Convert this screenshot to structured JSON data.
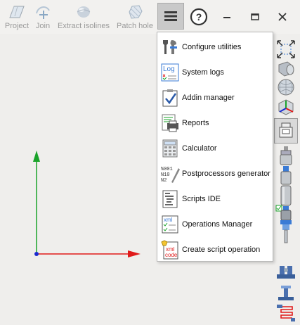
{
  "toolbar": {
    "items": [
      {
        "label": "Project",
        "icon": "project-icon"
      },
      {
        "label": "Join",
        "icon": "join-icon"
      },
      {
        "label": "Extract isolines",
        "icon": "extract-isolines-icon"
      },
      {
        "label": "Patch hole",
        "icon": "patch-hole-icon"
      }
    ],
    "menu_icon": "hamburger-menu-icon",
    "help_glyph": "?",
    "minimize_icon": "minimize-icon",
    "restore_icon": "restore-icon",
    "close_icon": "close-icon"
  },
  "menu": {
    "items": [
      {
        "label": "Configure utilities",
        "icon": "configure-utilities-icon"
      },
      {
        "label": "System logs",
        "icon": "system-logs-icon",
        "icon_text": "Log"
      },
      {
        "label": "Addin manager",
        "icon": "addin-manager-icon"
      },
      {
        "label": "Reports",
        "icon": "reports-icon"
      },
      {
        "label": "Calculator",
        "icon": "calculator-icon"
      },
      {
        "label": "Postprocessors generator",
        "icon": "postprocessors-generator-icon",
        "icon_text": [
          "%001",
          "N10",
          "N2"
        ]
      },
      {
        "label": "Scripts IDE",
        "icon": "scripts-ide-icon"
      },
      {
        "label": "Operations Manager",
        "icon": "operations-manager-icon",
        "icon_text": "xml"
      },
      {
        "label": "Create script operation",
        "icon": "create-script-operation-icon",
        "icon_text": [
          "xml",
          "code"
        ]
      }
    ]
  },
  "right_toolbar": {
    "items": [
      "fit-view-icon",
      "cylinder-stock-icon",
      "sphere-mesh-icon",
      "axes-cube-icon",
      "tool-holder-icon",
      "tool-shank-icon",
      "tool-cutter-icon",
      "tool-body-icon",
      "tool-assembly-icon",
      "spindle-icon",
      "vise-clamp-icon",
      "fixture-icon",
      "coolant-icon"
    ],
    "active_index": 4
  },
  "colors": {
    "y_axis": "#1aa32a",
    "x_axis": "#e01a1a",
    "origin": "#1a2ad0",
    "accent_blue": "#3a7bd5"
  }
}
